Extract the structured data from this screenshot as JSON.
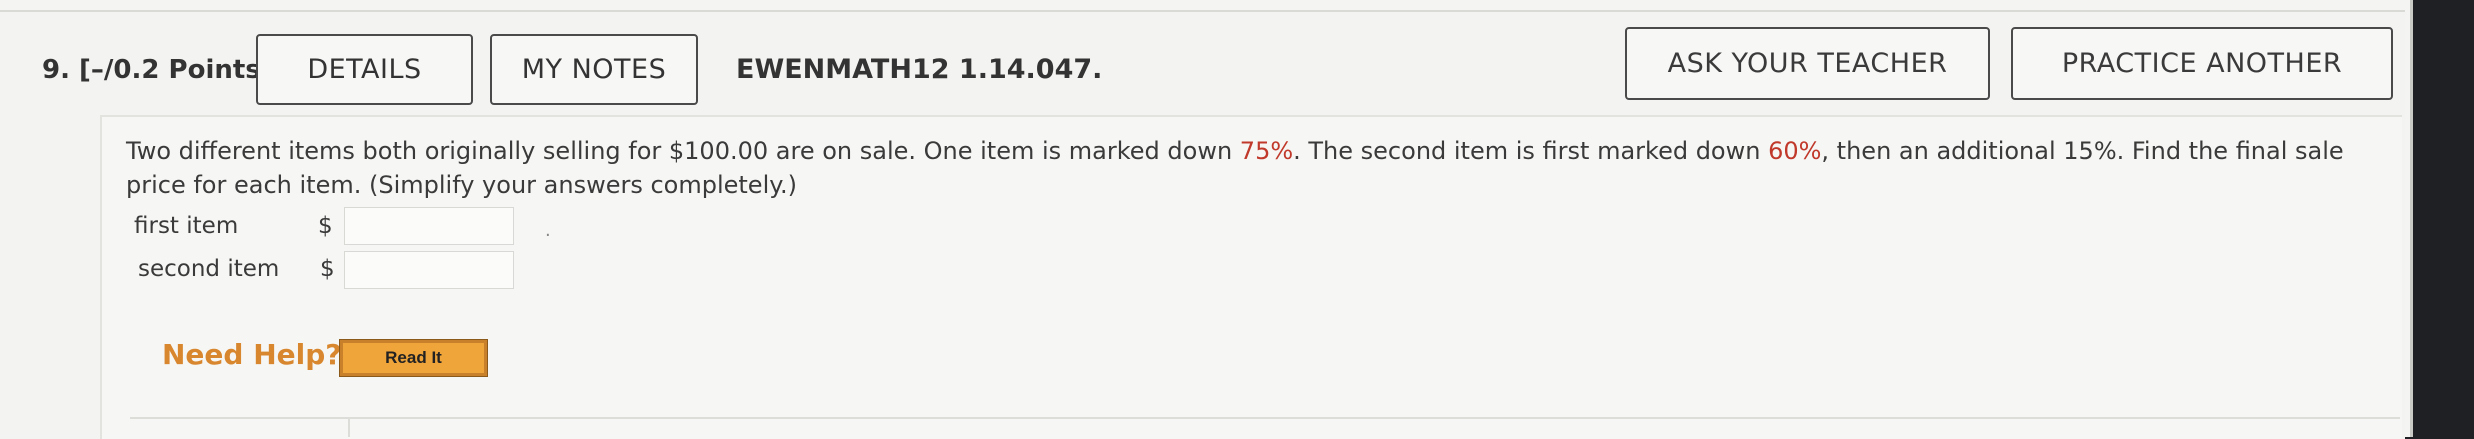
{
  "header": {
    "question_number": "9.",
    "points": "[–/0.2 Points]",
    "details_label": "DETAILS",
    "my_notes_label": "MY NOTES",
    "question_code": "EWENMATH12 1.14.047.",
    "ask_teacher_label": "ASK YOUR TEACHER",
    "practice_another_label": "PRACTICE ANOTHER"
  },
  "question": {
    "text_part1": "Two different items both originally selling for $100.00 are on sale. One item is marked down ",
    "highlight1": "75%",
    "text_part2": ". The second item is first marked down ",
    "highlight2": "60%",
    "text_part3": ", then an additional 15%. Find the final sale price for each item. (Simplify your answers completely.)",
    "highlight_color": "#c0392b"
  },
  "answers": [
    {
      "label": "first item",
      "prefix": "$",
      "value": ""
    },
    {
      "label": "second item",
      "prefix": "$",
      "value": ""
    }
  ],
  "help": {
    "need_help_label": "Need Help?",
    "read_it_label": "Read It"
  }
}
